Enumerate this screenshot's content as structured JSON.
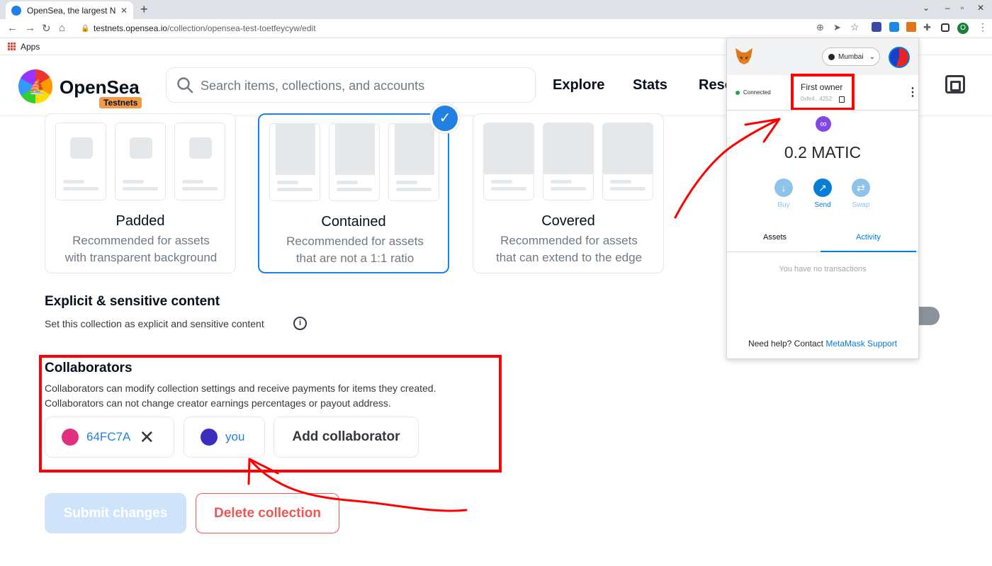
{
  "browser": {
    "tab_title": "OpenSea, the largest NFT",
    "url_host": "testnets.opensea.io",
    "url_path": "/collection/opensea-test-toetfeycyw/edit",
    "profile_initial": "O",
    "bookmark_apps": "Apps"
  },
  "header": {
    "brand": "OpenSea",
    "badge": "Testnets",
    "search_placeholder": "Search items, collections, and accounts",
    "nav": [
      "Explore",
      "Stats",
      "Reso"
    ]
  },
  "display_options": [
    {
      "title": "Padded",
      "desc_line1": "Recommended for assets",
      "desc_line2": "with transparent background"
    },
    {
      "title": "Contained",
      "desc_line1": "Recommended for assets",
      "desc_line2": "that are not a 1:1 ratio"
    },
    {
      "title": "Covered",
      "desc_line1": "Recommended for assets",
      "desc_line2": "that can extend to the edge"
    }
  ],
  "explicit": {
    "heading": "Explicit & sensitive content",
    "desc": "Set this collection as explicit and sensitive content"
  },
  "collaborators": {
    "heading": "Collaborators",
    "desc_line1": "Collaborators can modify collection settings and receive payments for items they created.",
    "desc_line2": "Collaborators can not change creator earnings percentages or payout address.",
    "items": [
      {
        "label": "64FC7A",
        "color": "#e0307f"
      },
      {
        "label": "you",
        "color": "#3b2dbf"
      }
    ],
    "add_label": "Add collaborator"
  },
  "actions": {
    "submit": "Submit changes",
    "delete": "Delete collection"
  },
  "metamask": {
    "network": "Mumbai",
    "status": "Connected",
    "account_name": "First owner",
    "account_address": "0xfe4...4252",
    "balance": "0.2 MATIC",
    "buttons": [
      "Buy",
      "Send",
      "Swap"
    ],
    "tabs": [
      "Assets",
      "Activity"
    ],
    "active_tab": "Activity",
    "empty_text": "You have no transactions",
    "help_text": "Need help? Contact ",
    "help_link": "MetaMask Support"
  },
  "colors": {
    "accent": "#2081e2",
    "annotation": "#ff0000",
    "metamask_blue": "#037dd6"
  }
}
